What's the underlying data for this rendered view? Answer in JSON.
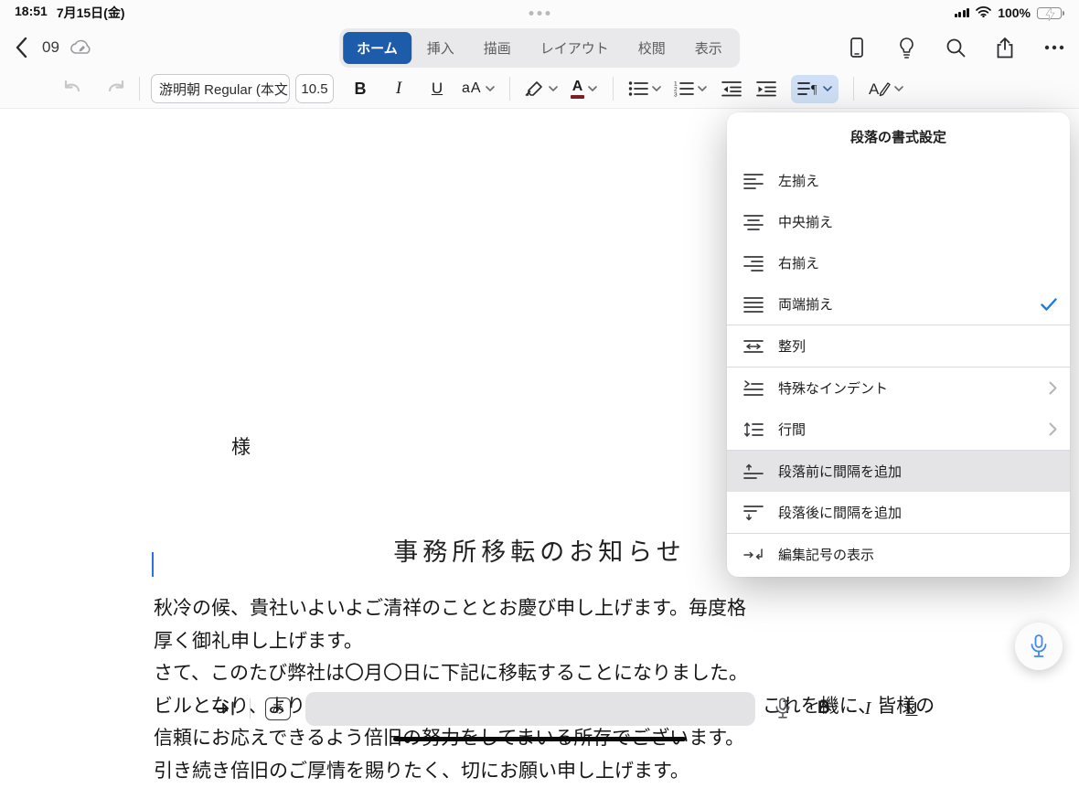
{
  "status_bar": {
    "time": "18:51",
    "date": "7月15日(金)",
    "battery_percent": "100%"
  },
  "header": {
    "doc_title": "09",
    "tabs": [
      {
        "label": "ホーム",
        "active": true
      },
      {
        "label": "挿入",
        "active": false
      },
      {
        "label": "描画",
        "active": false
      },
      {
        "label": "レイアウト",
        "active": false
      },
      {
        "label": "校閲",
        "active": false
      },
      {
        "label": "表示",
        "active": false
      }
    ]
  },
  "toolbar": {
    "font_name": "游明朝 Regular (本文",
    "font_size": "10.5",
    "bold_label": "B",
    "italic_label": "I",
    "underline_label": "U",
    "case_label": "aA",
    "color_letter": "A"
  },
  "document": {
    "salutation": "様",
    "title": "事務所移転のお知らせ",
    "body": [
      "秋冷の候、貴社いよいよご清祥のこととお慶び申し上げます。毎度格",
      "厚く御礼申し上げます。",
      "さて、このたび弊社は〇月〇日に下記に移転することになりました。",
      "ビルとなり、よりアクティブな営業活動の拠点になることと存じます。これを機に、皆様の",
      "信頼にお応えできるよう倍旧の努力をしてまいる所存でございます。",
      "引き続き倍旧のご厚情を賜りたく、切にお願い申し上げます。"
    ]
  },
  "menu": {
    "title": "段落の書式設定",
    "items": [
      {
        "label": "左揃え",
        "icon": "align-left-icon",
        "checked": false
      },
      {
        "label": "中央揃え",
        "icon": "align-center-icon",
        "checked": false
      },
      {
        "label": "右揃え",
        "icon": "align-right-icon",
        "checked": false
      },
      {
        "label": "両端揃え",
        "icon": "align-justify-icon",
        "checked": true
      },
      {
        "label": "整列",
        "icon": "distribute-icon",
        "checked": false
      },
      {
        "label": "特殊なインデント",
        "icon": "special-indent-icon",
        "submenu": true
      },
      {
        "label": "行間",
        "icon": "line-spacing-icon",
        "submenu": true
      },
      {
        "label": "段落前に間隔を追加",
        "icon": "space-before-icon",
        "highlighted": true
      },
      {
        "label": "段落後に間隔を追加",
        "icon": "space-after-icon",
        "highlighted": false
      },
      {
        "label": "編集記号の表示",
        "icon": "show-marks-icon",
        "highlighted": false
      }
    ]
  },
  "accessory_bar": {
    "keyboard_lang": "あ",
    "bold_label": "B",
    "italic_label": "I",
    "underline_label": "U"
  },
  "colors": {
    "accent_blue": "#1d5bab",
    "selection_blue": "#cfe0f6",
    "check_blue": "#1d7ae2",
    "battery_green": "#35c759"
  }
}
